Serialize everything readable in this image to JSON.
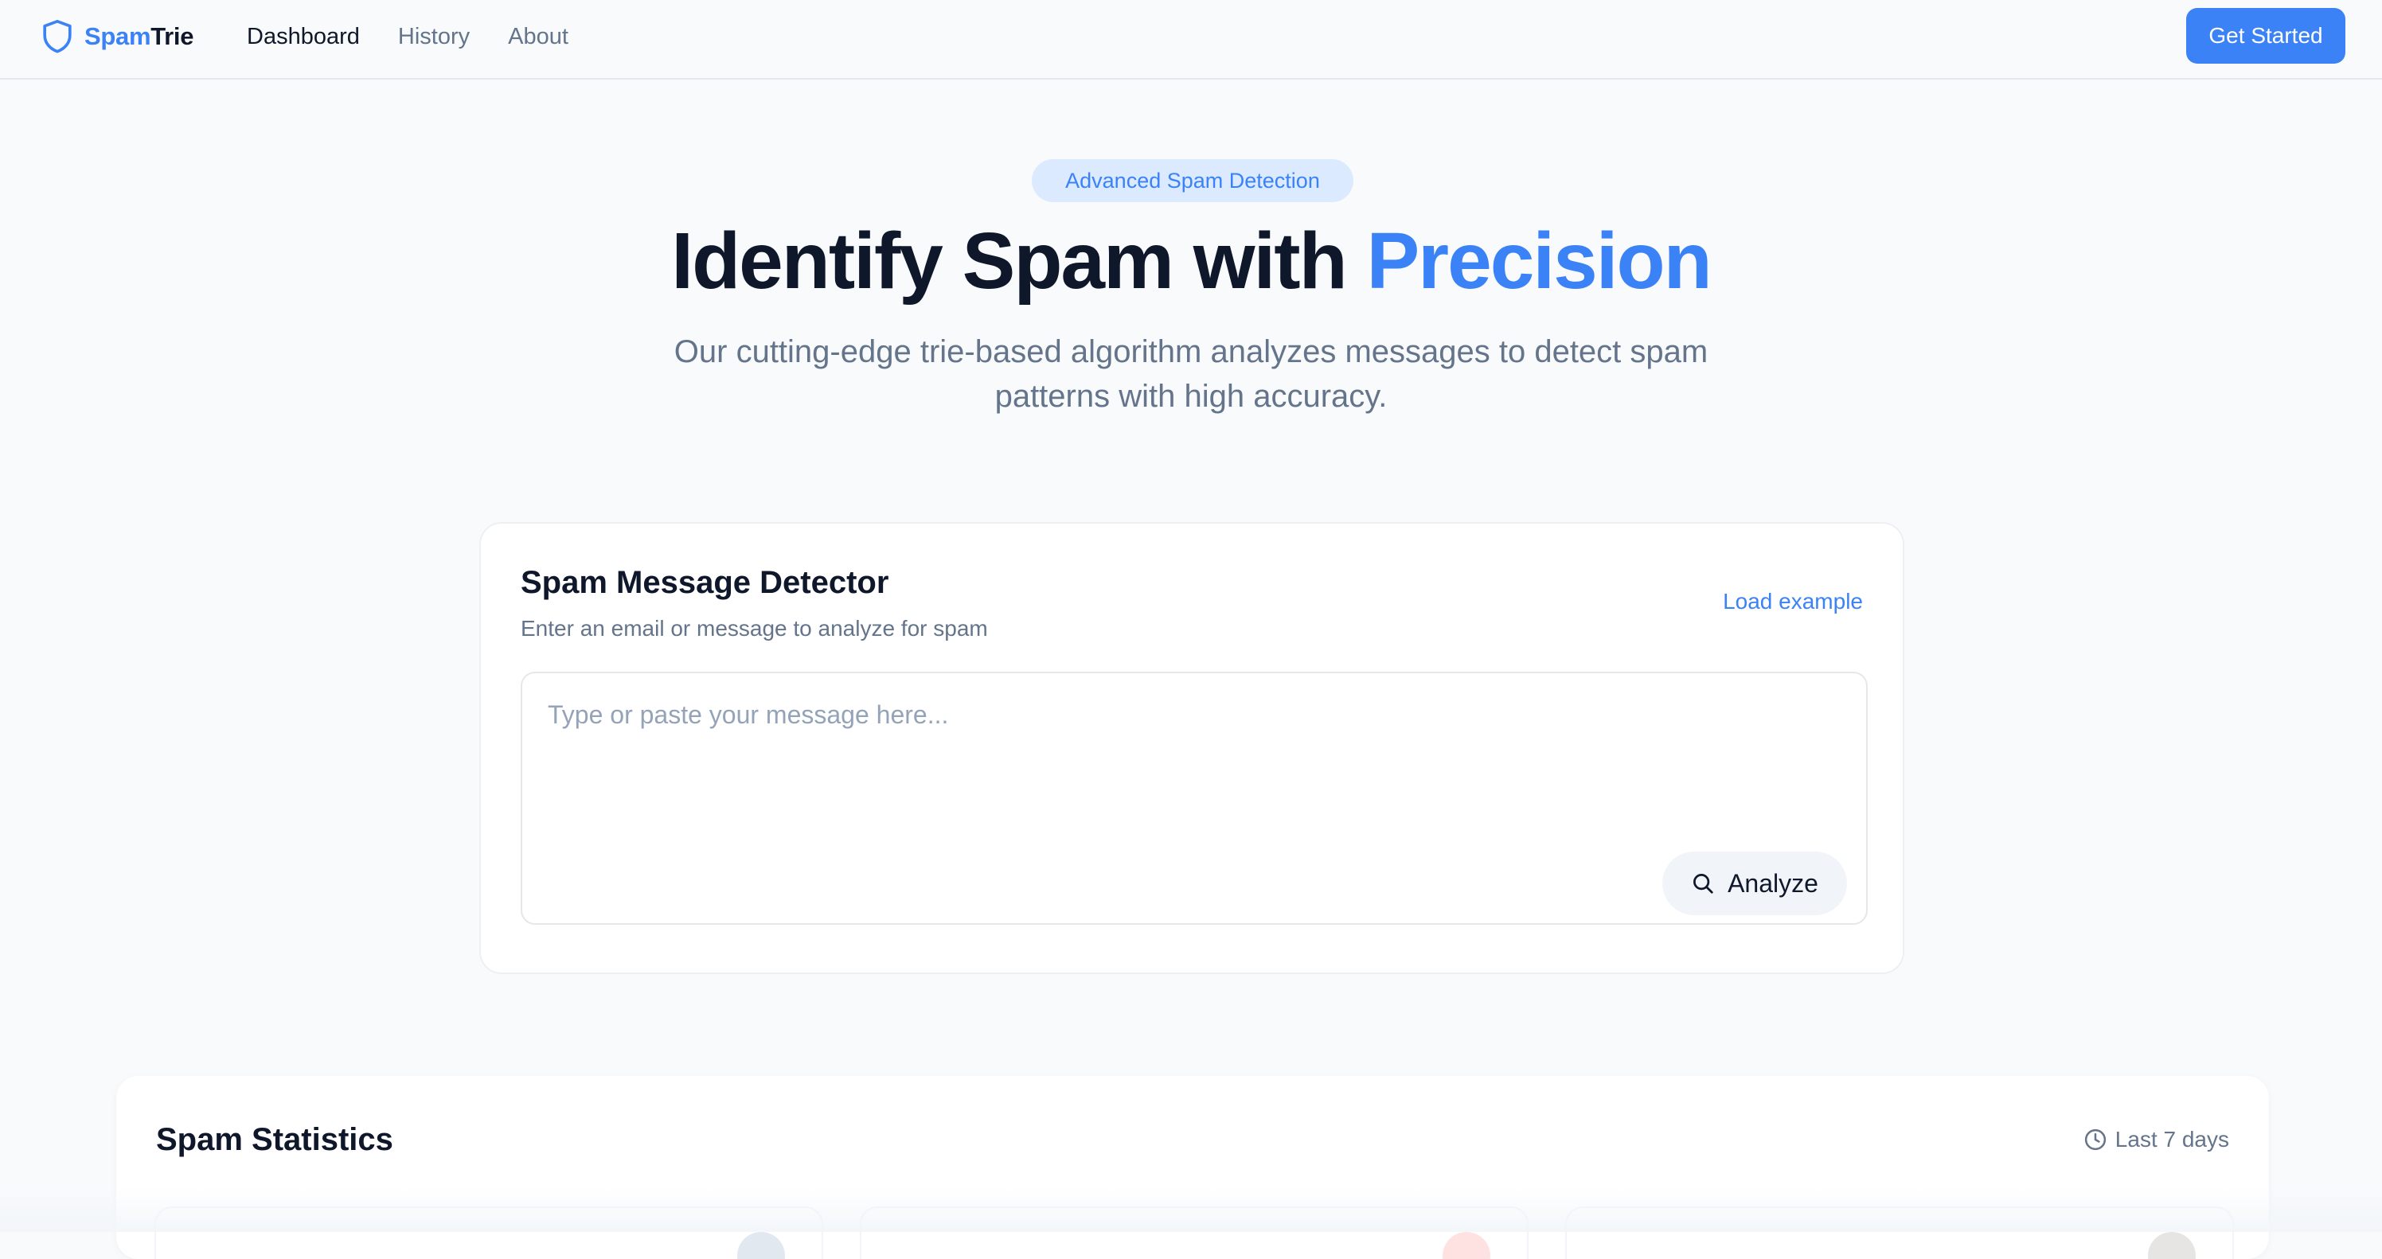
{
  "brand": {
    "name_part1": "Spam",
    "name_part2": "Trie",
    "icon": "shield-icon"
  },
  "nav": {
    "items": [
      {
        "label": "Dashboard",
        "active": true
      },
      {
        "label": "History",
        "active": false
      },
      {
        "label": "About",
        "active": false
      }
    ],
    "cta_label": "Get Started"
  },
  "hero": {
    "badge": "Advanced Spam Detection",
    "title_main": "Identify Spam with ",
    "title_accent": "Precision",
    "subtitle": "Our cutting-edge trie-based algorithm analyzes messages to detect spam patterns with high accuracy."
  },
  "detector": {
    "title": "Spam Message Detector",
    "subtitle": "Enter an email or message to analyze for spam",
    "load_example_label": "Load example",
    "input_placeholder": "Type or paste your message here...",
    "input_value": "",
    "analyze_label": "Analyze",
    "analyze_icon": "search-icon"
  },
  "stats": {
    "title": "Spam Statistics",
    "range_label": "Last 7 days",
    "range_icon": "clock-icon"
  },
  "colors": {
    "accent": "#3b82f6",
    "accent_light": "#dbeafe",
    "text_primary": "#0f172a",
    "text_muted": "#64748b",
    "background": "#f8fafc",
    "danger_light": "#fee2e2"
  }
}
